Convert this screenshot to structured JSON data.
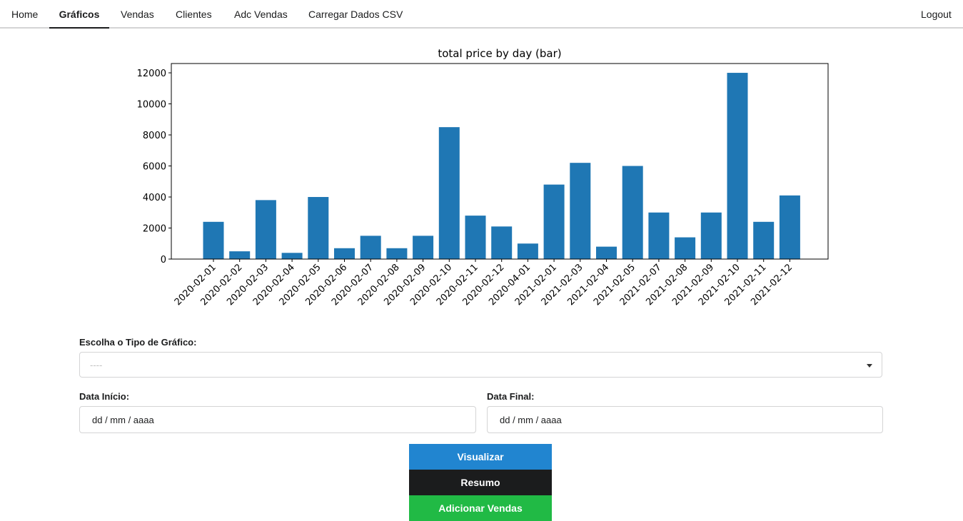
{
  "nav": {
    "items": [
      "Home",
      "Gráficos",
      "Vendas",
      "Clientes",
      "Adc Vendas",
      "Carregar Dados CSV"
    ],
    "active": "Gráficos",
    "logout": "Logout"
  },
  "form": {
    "chart_type_label": "Escolha o Tipo de Gráfico:",
    "chart_type_value": "----",
    "start_label": "Data Início:",
    "start_value": "dd / mm / aaaa",
    "end_label": "Data Final:",
    "end_value": "dd / mm / aaaa"
  },
  "buttons": {
    "visualize": "Visualizar",
    "summary": "Resumo",
    "add_sales": "Adicionar Vendas"
  },
  "colors": {
    "bar": "#1f77b4",
    "blue_button": "#2185d0",
    "black_button": "#1b1c1d",
    "green_button": "#21ba45"
  },
  "chart_data": {
    "type": "bar",
    "title": "total price by day (bar)",
    "categories": [
      "2020-02-01",
      "2020-02-02",
      "2020-02-03",
      "2020-02-04",
      "2020-02-05",
      "2020-02-06",
      "2020-02-07",
      "2020-02-08",
      "2020-02-09",
      "2020-02-10",
      "2020-02-11",
      "2020-02-12",
      "2020-04-01",
      "2021-02-01",
      "2021-02-03",
      "2021-02-04",
      "2021-02-05",
      "2021-02-07",
      "2021-02-08",
      "2021-02-09",
      "2021-02-10",
      "2021-02-11",
      "2021-02-12"
    ],
    "values": [
      2400,
      500,
      3800,
      400,
      4000,
      700,
      1500,
      700,
      1500,
      8500,
      2800,
      2100,
      1000,
      4800,
      6200,
      800,
      6000,
      3000,
      1400,
      3000,
      12000,
      2400,
      4100
    ],
    "yticks": [
      0,
      2000,
      4000,
      6000,
      8000,
      10000,
      12000
    ],
    "ylim": [
      0,
      12600
    ],
    "xlabel": "",
    "ylabel": "",
    "grid": false
  }
}
